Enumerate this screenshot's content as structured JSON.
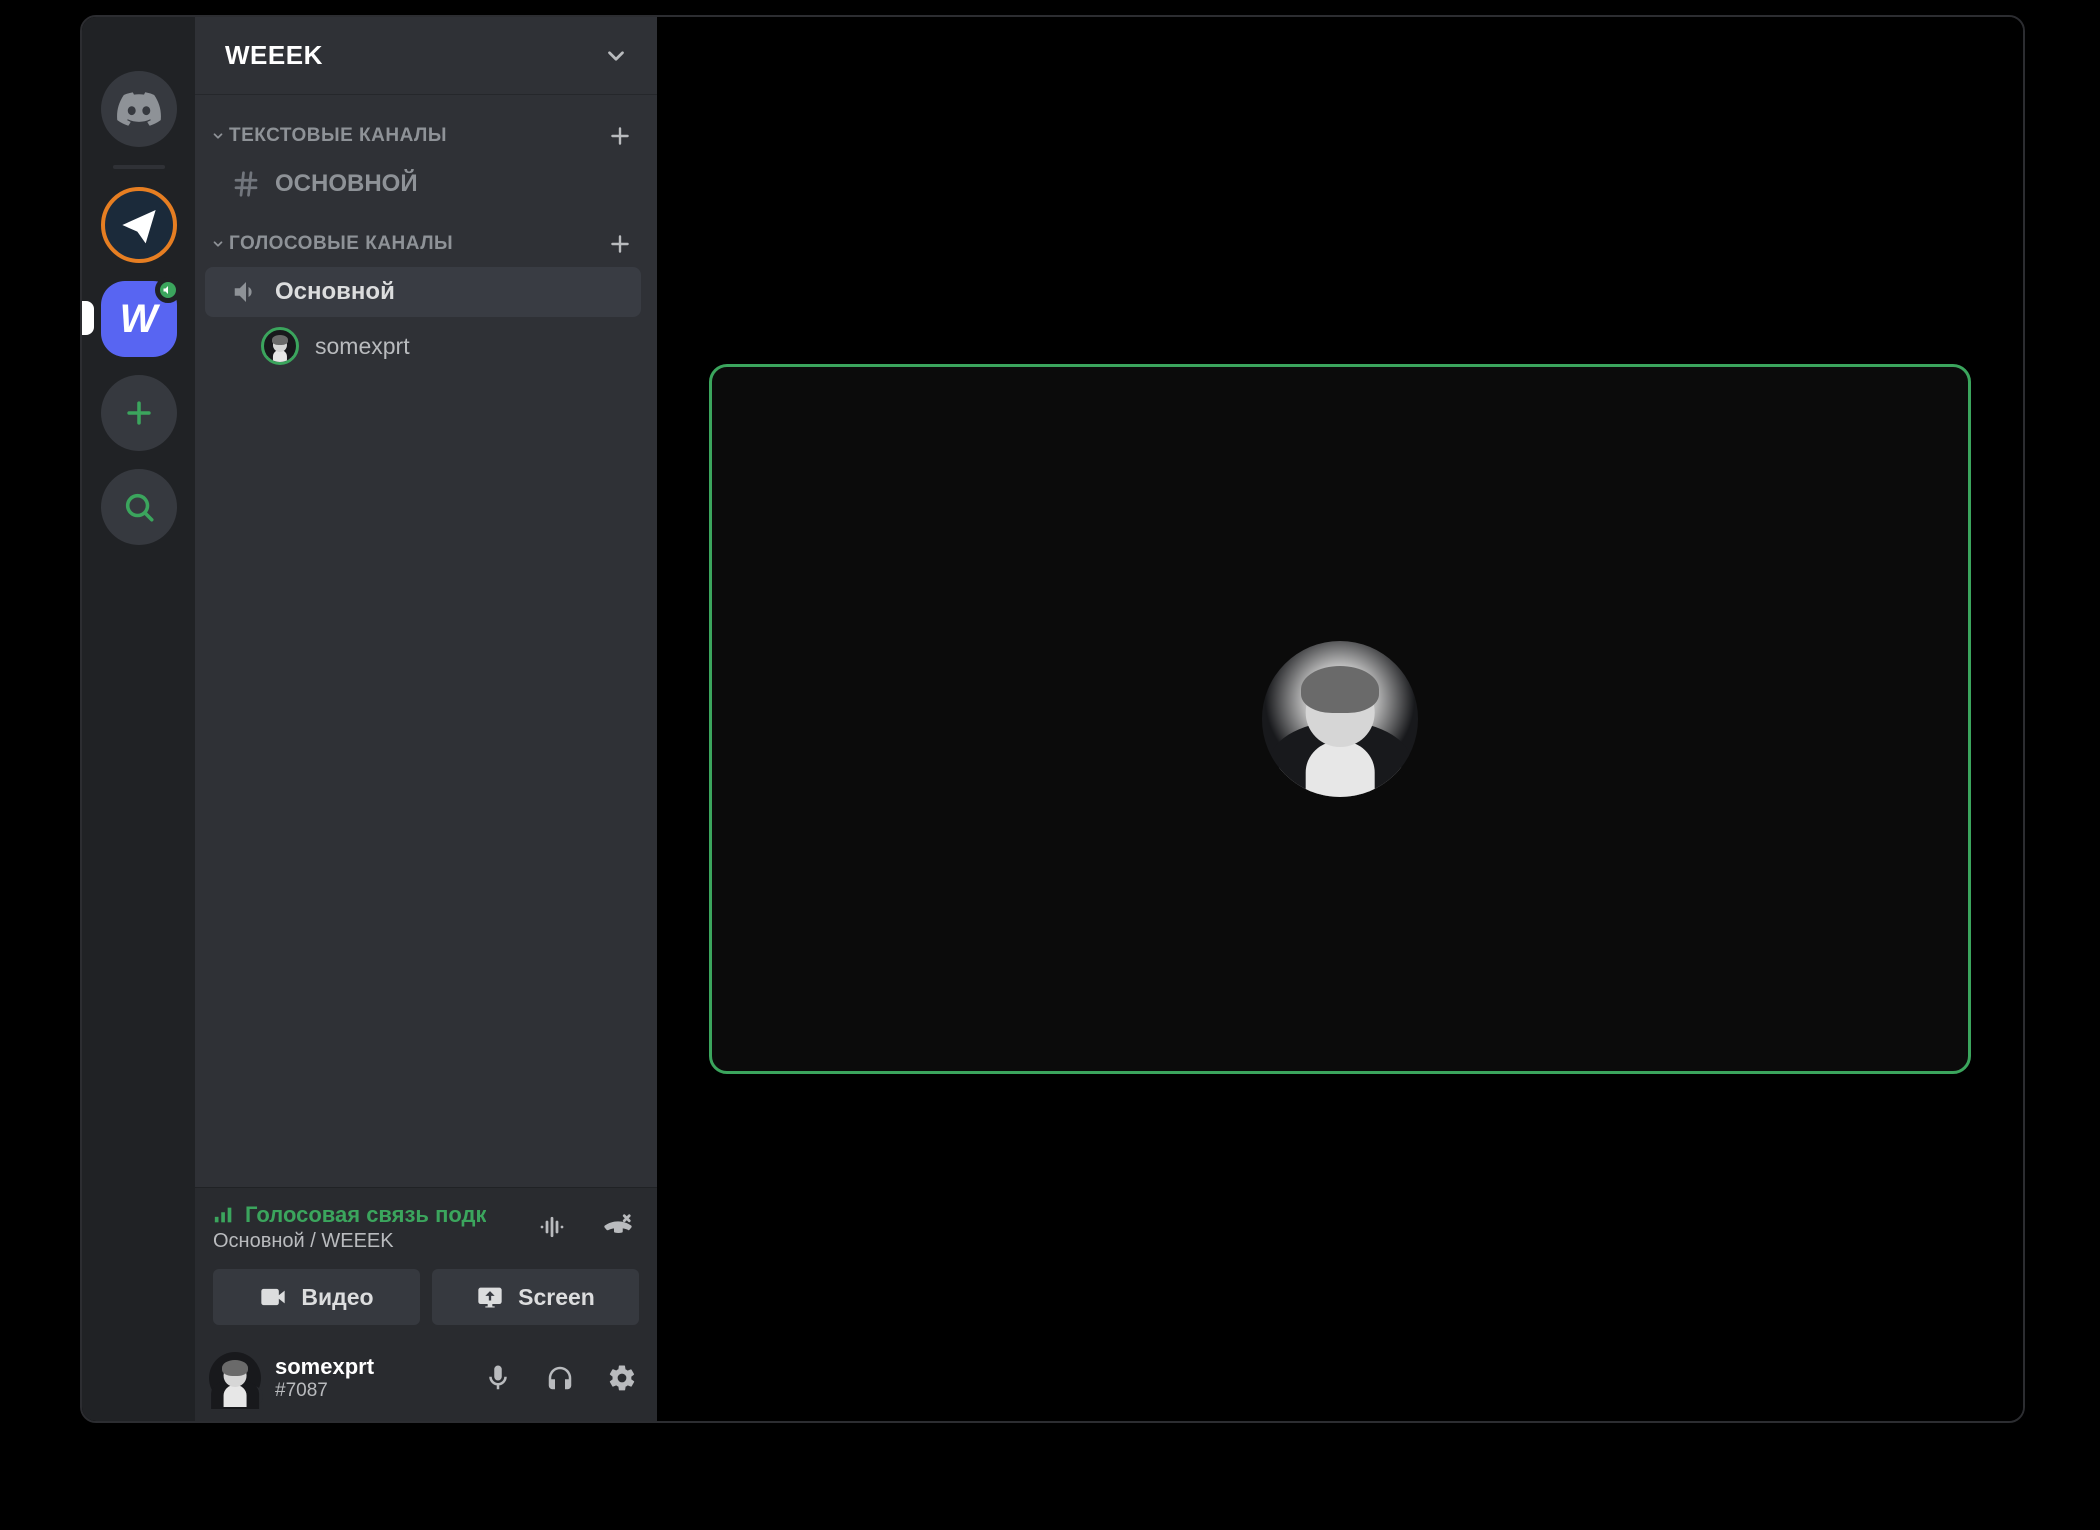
{
  "server": {
    "name": "WEEEK"
  },
  "categories": {
    "text": {
      "label": "ТЕКСТОВЫЕ КАНАЛЫ",
      "channels": [
        {
          "name": "основной"
        }
      ]
    },
    "voice": {
      "label": "ГОЛОСОВЫЕ КАНАЛЫ",
      "channels": [
        {
          "name": "Основной"
        }
      ],
      "users": [
        {
          "name": "somexprt"
        }
      ]
    }
  },
  "connection": {
    "status_text": "Голосовая связь подк",
    "location": "Основной / WEEEK",
    "video_label": "Видео",
    "screen_label": "Screen"
  },
  "user": {
    "name": "somexprt",
    "tag": "#7087"
  },
  "rail": {
    "discord": "discord-home",
    "servers": [
      {
        "id": "server-t",
        "letter": ""
      },
      {
        "id": "server-weeek",
        "letter": "W"
      }
    ]
  },
  "colors": {
    "accent_green": "#3ba55d",
    "blurple": "#5865f2"
  }
}
